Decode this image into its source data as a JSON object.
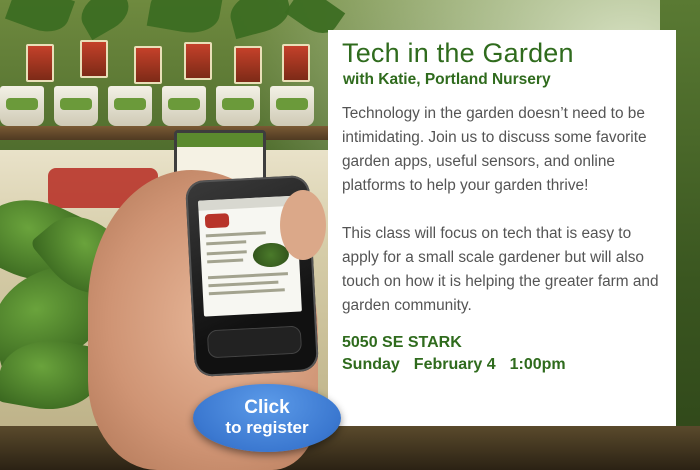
{
  "event": {
    "title": "Tech in the Garden",
    "subtitle": "with Katie, Portland Nursery",
    "description_1": "Technology in the garden doesn’t need to be intimidating. Join us to discuss some favorite garden apps, useful sensors, and online platforms to help your garden thrive!",
    "description_2": "This class will focus on tech that is easy to apply for a small scale gardener but will also touch on how it is helping the greater farm and garden community.",
    "address": "5050 SE STARK",
    "day": "Sunday",
    "date": "February 4",
    "time": "1:00pm"
  },
  "register": {
    "line1": "Click",
    "line2": "to register"
  },
  "colors": {
    "accent_green": "#2f6b1d",
    "body_text": "#545454",
    "button_blue": "#3b78d0"
  }
}
